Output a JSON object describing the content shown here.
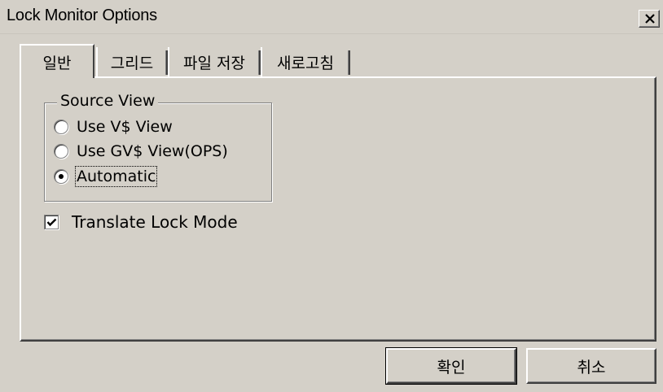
{
  "window": {
    "title": "Lock Monitor Options",
    "close_icon": "close-icon"
  },
  "tabs": [
    {
      "label": "일반",
      "active": true
    },
    {
      "label": "그리드",
      "active": false
    },
    {
      "label": "파일 저장",
      "active": false
    },
    {
      "label": "새로고침",
      "active": false
    }
  ],
  "source_view": {
    "label": "Source View",
    "options": [
      {
        "label": "Use V$ View",
        "selected": false
      },
      {
        "label": "Use GV$ View(OPS)",
        "selected": false
      },
      {
        "label": "Automatic",
        "selected": true
      }
    ]
  },
  "translate_lock_mode": {
    "label": "Translate Lock Mode",
    "checked": true
  },
  "buttons": {
    "ok": "확인",
    "cancel": "취소"
  },
  "colors": {
    "face": "#d4d0c8",
    "highlight": "#ffffff",
    "shadow": "#808080",
    "dark_shadow": "#404040"
  }
}
